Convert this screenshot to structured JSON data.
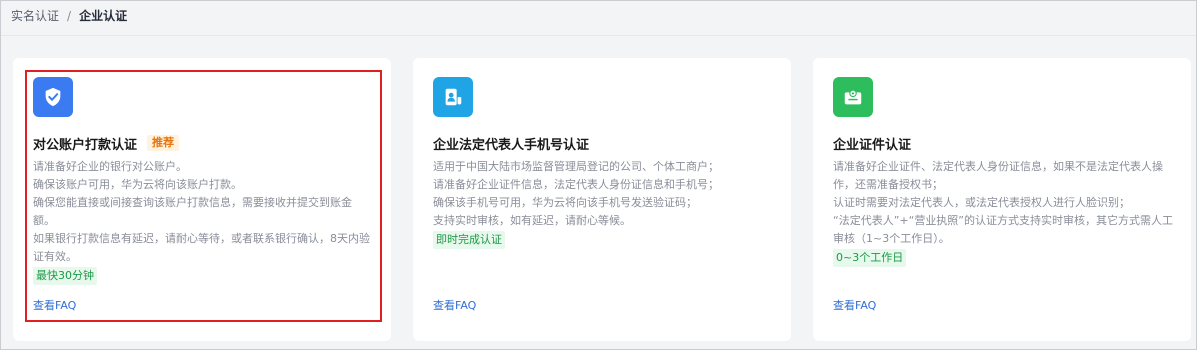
{
  "breadcrumb": {
    "parent": "实名认证",
    "separator": "/",
    "current": "企业认证"
  },
  "cards": [
    {
      "icon": "shield-check-icon",
      "icon_color": "#3a7bf2",
      "title": "对公账户打款认证",
      "tag": "推荐",
      "lines": [
        "请准备好企业的银行对公账户。",
        "确保该账户可用，华为云将向该账户打款。",
        "确保您能直接或间接查询该账户打款信息，需要接收并提交到账金额。",
        "如果银行打款信息有延迟，请耐心等待，或者联系银行确认，8天内验证有效。"
      ],
      "badge": "最快30分钟",
      "faq": "查看FAQ",
      "selected": true
    },
    {
      "icon": "person-phone-icon",
      "icon_color": "#1fa5e6",
      "title": "企业法定代表人手机号认证",
      "lines": [
        "适用于中国大陆市场监督管理局登记的公司、个体工商户；",
        "请准备好企业证件信息，法定代表人身份证信息和手机号；",
        "确保该手机号可用，华为云将向该手机号发送验证码；",
        "支持实时审核，如有延迟，请耐心等候。"
      ],
      "badge": "即时完成认证",
      "faq": "查看FAQ"
    },
    {
      "icon": "certificate-icon",
      "icon_color": "#2dbd5c",
      "title": "企业证件认证",
      "lines": [
        "请准备好企业证件、法定代表人身份证信息，如果不是法定代表人操作，还需准备授权书；",
        "认证时需要对法定代表人，或法定代表授权人进行人脸识别；",
        "“法定代表人”+“营业执照”的认证方式支持实时审核，其它方式需人工审核（1~3个工作日）。"
      ],
      "badge": "0~3个工作日",
      "faq": "查看FAQ"
    }
  ]
}
